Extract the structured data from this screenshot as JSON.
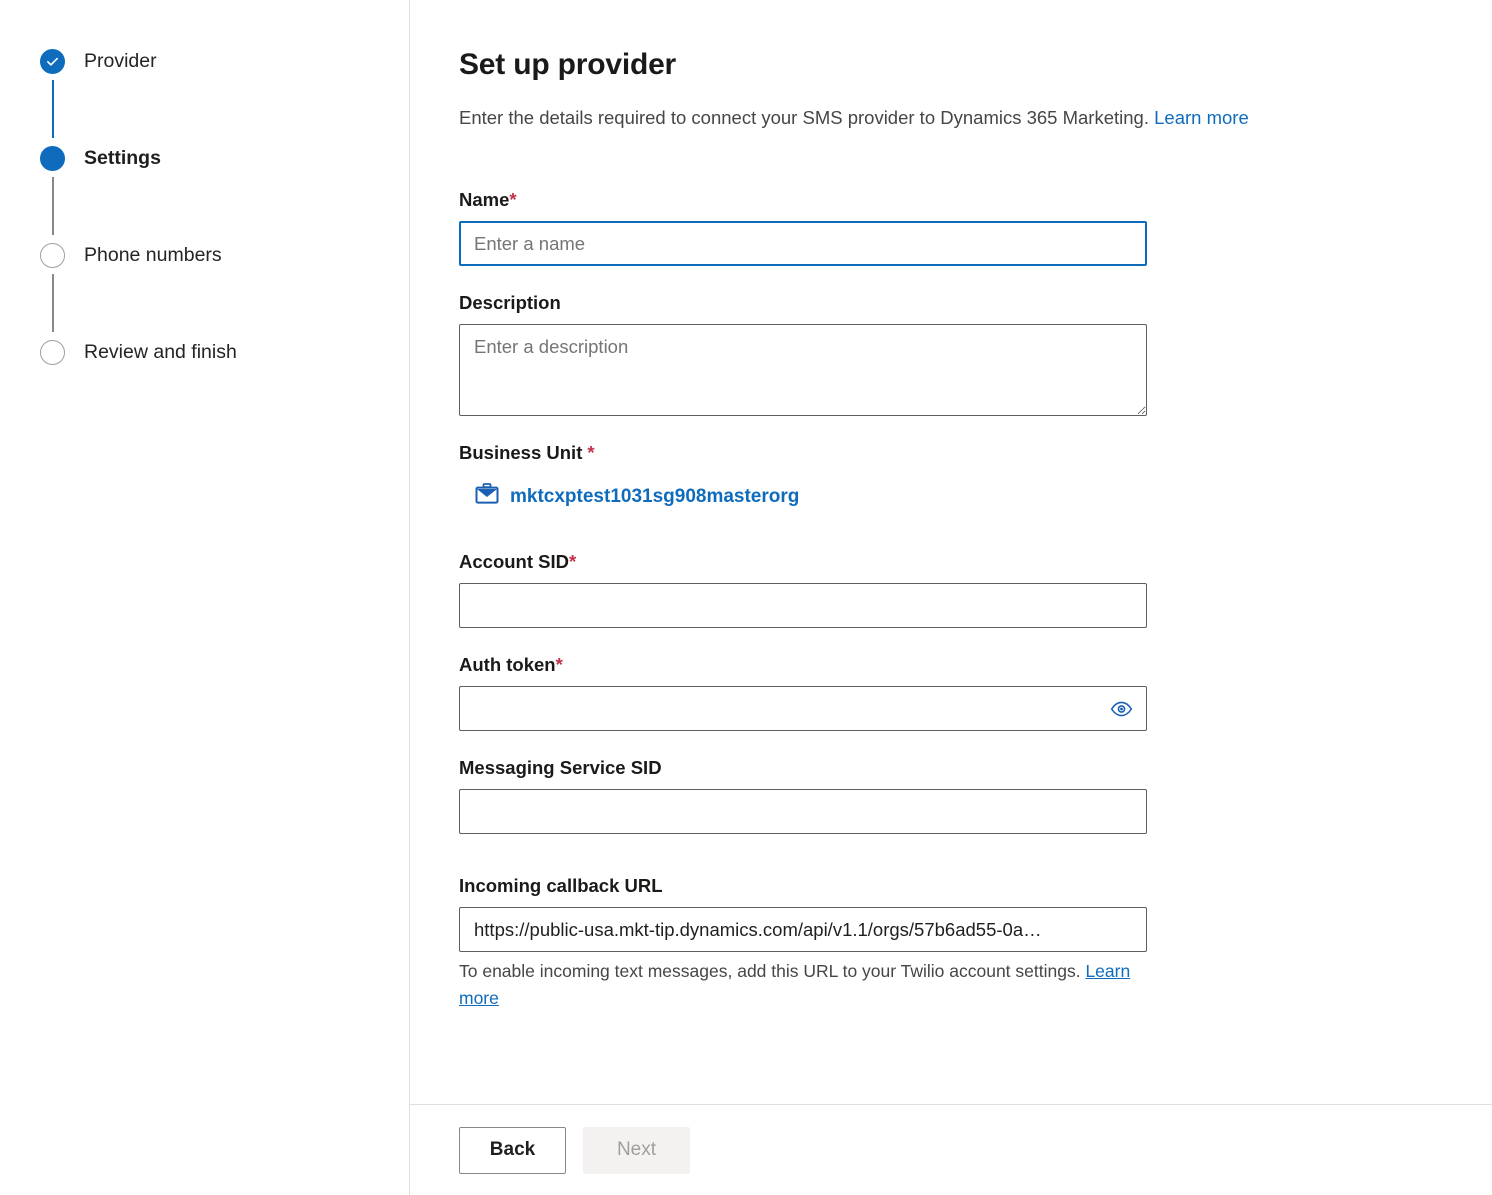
{
  "stepper": {
    "steps": [
      {
        "label": "Provider",
        "state": "done",
        "marker_icon": "check-icon"
      },
      {
        "label": "Settings",
        "state": "current",
        "marker_icon": "filled-circle-icon"
      },
      {
        "label": "Phone numbers",
        "state": "todo",
        "marker_icon": "empty-circle-icon"
      },
      {
        "label": "Review and finish",
        "state": "todo",
        "marker_icon": "empty-circle-icon"
      }
    ]
  },
  "header": {
    "title": "Set up provider",
    "subtitle": "Enter the details required to connect your SMS provider to Dynamics 365 Marketing.",
    "learn_more": "Learn more"
  },
  "form": {
    "name": {
      "label": "Name",
      "required_mark": "*",
      "placeholder": "Enter a name",
      "value": ""
    },
    "description": {
      "label": "Description",
      "placeholder": "Enter a description",
      "value": ""
    },
    "business_unit": {
      "label": "Business Unit",
      "required_mark": "*",
      "icon": "briefcase-icon",
      "value": "mktcxptest1031sg908masterorg"
    },
    "account_sid": {
      "label": "Account SID",
      "required_mark": "*",
      "placeholder": "",
      "value": ""
    },
    "auth_token": {
      "label": "Auth token",
      "required_mark": "*",
      "placeholder": "",
      "value": "",
      "reveal_icon": "eye-icon"
    },
    "messaging_service_sid": {
      "label": "Messaging Service SID",
      "placeholder": "",
      "value": ""
    },
    "incoming_callback_url": {
      "label": "Incoming callback URL",
      "value": "https://public-usa.mkt-tip.dynamics.com/api/v1.1/orgs/57b6ad55-0a…",
      "hint": "To enable incoming text messages, add this URL to your Twilio account settings.",
      "hint_link": "Learn more"
    }
  },
  "footer": {
    "back_label": "Back",
    "next_label": "Next",
    "next_disabled": true
  },
  "colors": {
    "accent": "#0f6cbd",
    "required": "#c4314b",
    "border": "#605e5c",
    "divider": "#e1dfdd",
    "disabled_bg": "#f3f2f1",
    "disabled_text": "#a19f9d"
  }
}
